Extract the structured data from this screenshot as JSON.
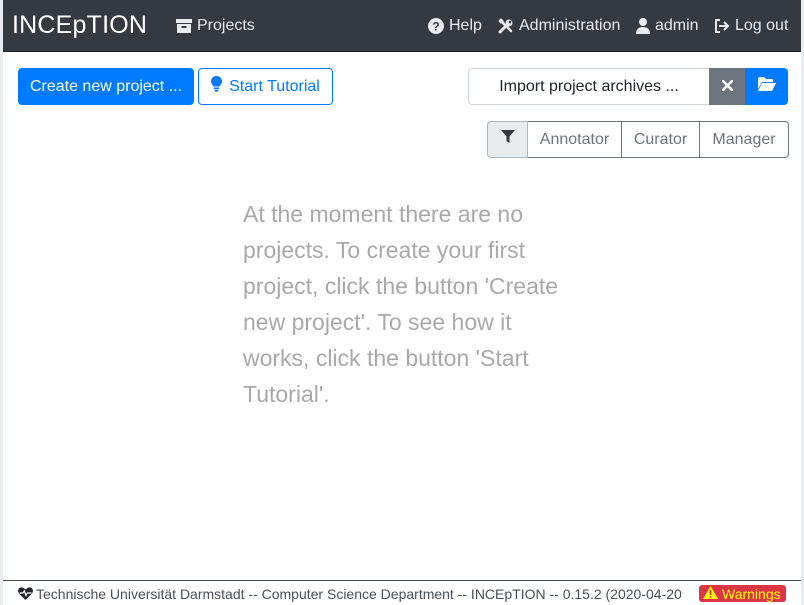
{
  "app": {
    "brand": "INCEpTION"
  },
  "nav": {
    "projects": {
      "label": "Projects",
      "icon": "archive-icon"
    },
    "help": {
      "label": "Help",
      "icon": "question-circle-icon"
    },
    "administration": {
      "label": "Administration",
      "icon": "tools-icon"
    },
    "user": {
      "label": "admin",
      "icon": "user-icon"
    },
    "logout": {
      "label": "Log out",
      "icon": "sign-out-icon"
    }
  },
  "toolbar": {
    "create_label": "Create new project ...",
    "tutorial_label": "Start Tutorial",
    "tutorial_icon": "lightbulb-icon",
    "import_label": "Import project archives ...",
    "clear_icon": "times-icon",
    "open_icon": "folder-open-icon"
  },
  "filters": {
    "icon": "filter-icon",
    "roles": [
      "Annotator",
      "Curator",
      "Manager"
    ]
  },
  "main": {
    "empty_message": "At the moment there are no projects. To create your first project, click the button 'Create new project'. To see how it works, click the button 'Start Tutorial'."
  },
  "footer": {
    "text": "Technische Universität Darmstadt -- Computer Science Department -- INCEpTION -- 0.15.2 (2020-04-20",
    "warnings_label": "Warnings",
    "heart_icon": "heartbeat-icon",
    "warning_icon": "warning-triangle-icon"
  },
  "colors": {
    "navbar": "#343a40",
    "primary": "#007bff",
    "secondary": "#6c757d",
    "danger": "#dc3545",
    "warning_text": "#ffff00"
  }
}
